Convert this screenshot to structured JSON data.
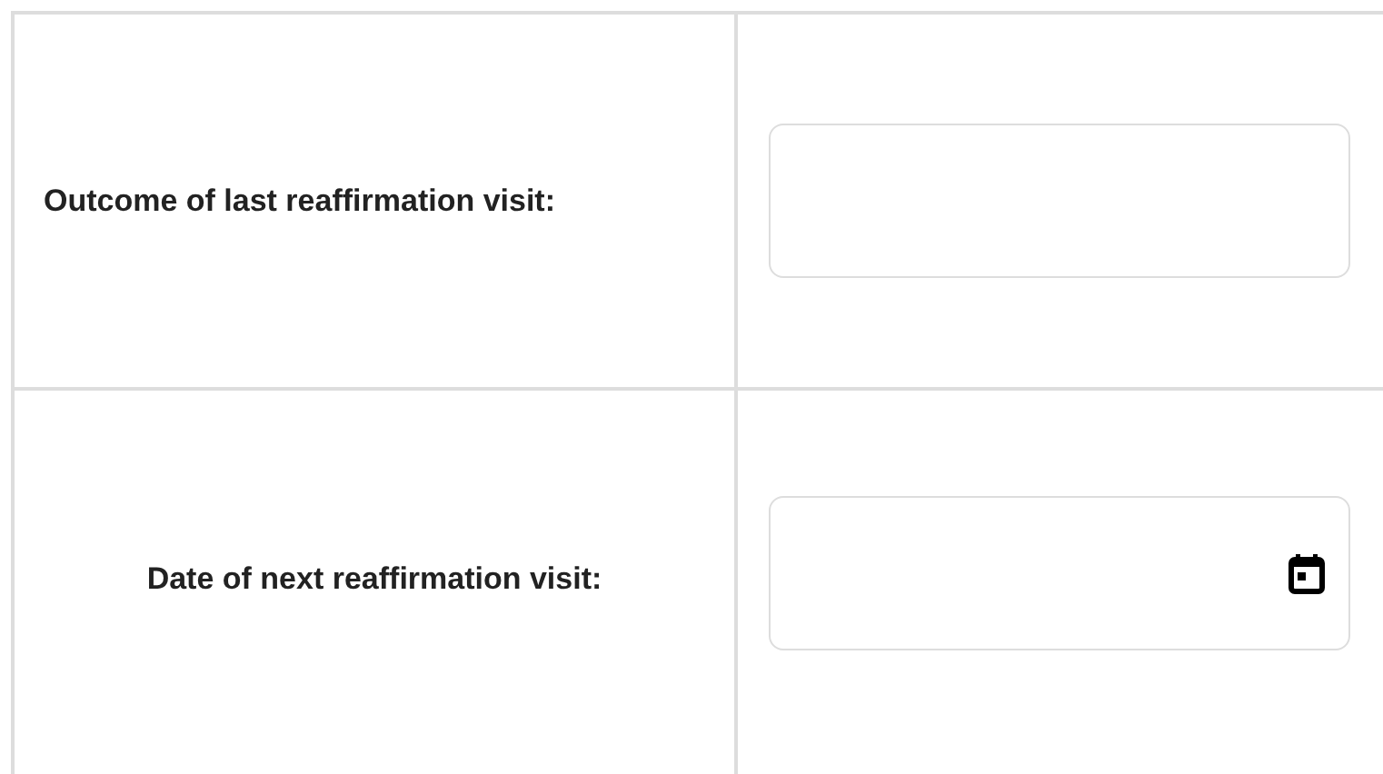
{
  "rows": [
    {
      "label": "Outcome of last reaffirmation visit:",
      "field": {
        "kind": "text"
      }
    },
    {
      "label": "Date of next reaffirmation visit:",
      "field": {
        "kind": "date"
      }
    }
  ]
}
